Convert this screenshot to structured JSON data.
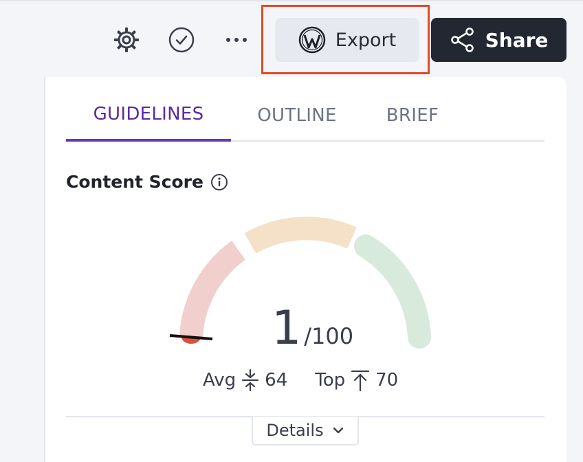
{
  "toolbar": {
    "settings_icon": "gear-cog-icon",
    "check_icon": "check-circle-icon",
    "more_label": "•••",
    "export_label": "Export",
    "share_label": "Share"
  },
  "tabs": [
    {
      "label": "GUIDELINES",
      "active": true
    },
    {
      "label": "OUTLINE",
      "active": false
    },
    {
      "label": "BRIEF",
      "active": false
    }
  ],
  "content_score": {
    "title": "Content Score",
    "value": "1",
    "max": "/100",
    "score_fraction": 0.01,
    "avg_label": "Avg",
    "avg_value": "64",
    "top_label": "Top",
    "top_value": "70"
  },
  "details_label": "Details",
  "colors": {
    "accent": "#5b2aa0",
    "gauge_low": "#f1cfcc",
    "gauge_mid": "#f5e0c8",
    "gauge_high": "#d7eadb",
    "marker": "#d9523a",
    "share_bg": "#232732",
    "highlight": "#e04a27"
  }
}
